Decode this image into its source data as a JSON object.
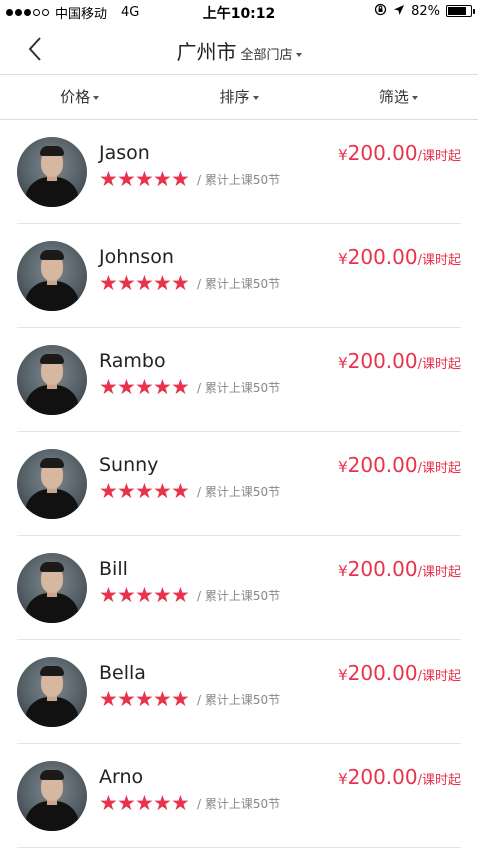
{
  "status": {
    "carrier": "中国移动",
    "network": "4G",
    "time": "上午10:12",
    "battery": "82%",
    "battery_level": 0.82
  },
  "nav": {
    "city": "广州市",
    "store": "全部门店"
  },
  "filters": [
    "价格",
    "排序",
    "筛选"
  ],
  "coaches": [
    {
      "name": "Jason",
      "rating": 5,
      "lessons": "/ 累计上课50节",
      "price_currency": "¥",
      "price_amount": "200.00",
      "price_unit": "/课时起"
    },
    {
      "name": "Johnson",
      "rating": 5,
      "lessons": "/ 累计上课50节",
      "price_currency": "¥",
      "price_amount": "200.00",
      "price_unit": "/课时起"
    },
    {
      "name": "Rambo",
      "rating": 5,
      "lessons": "/ 累计上课50节",
      "price_currency": "¥",
      "price_amount": "200.00",
      "price_unit": "/课时起"
    },
    {
      "name": "Sunny",
      "rating": 5,
      "lessons": "/ 累计上课50节",
      "price_currency": "¥",
      "price_amount": "200.00",
      "price_unit": "/课时起"
    },
    {
      "name": "Bill",
      "rating": 5,
      "lessons": "/ 累计上课50节",
      "price_currency": "¥",
      "price_amount": "200.00",
      "price_unit": "/课时起"
    },
    {
      "name": "Bella",
      "rating": 5,
      "lessons": "/ 累计上课50节",
      "price_currency": "¥",
      "price_amount": "200.00",
      "price_unit": "/课时起"
    },
    {
      "name": "Arno",
      "rating": 5,
      "lessons": "/ 累计上课50节",
      "price_currency": "¥",
      "price_amount": "200.00",
      "price_unit": "/课时起"
    }
  ],
  "colors": {
    "accent": "#e8334a",
    "muted_text": "#888888",
    "divider": "#e5e5e5"
  },
  "icons": {
    "back": "chevron-left-icon",
    "dropdown": "caret-down-icon",
    "star": "star-icon",
    "location": "location-arrow-icon",
    "lock": "orientation-lock-icon"
  }
}
